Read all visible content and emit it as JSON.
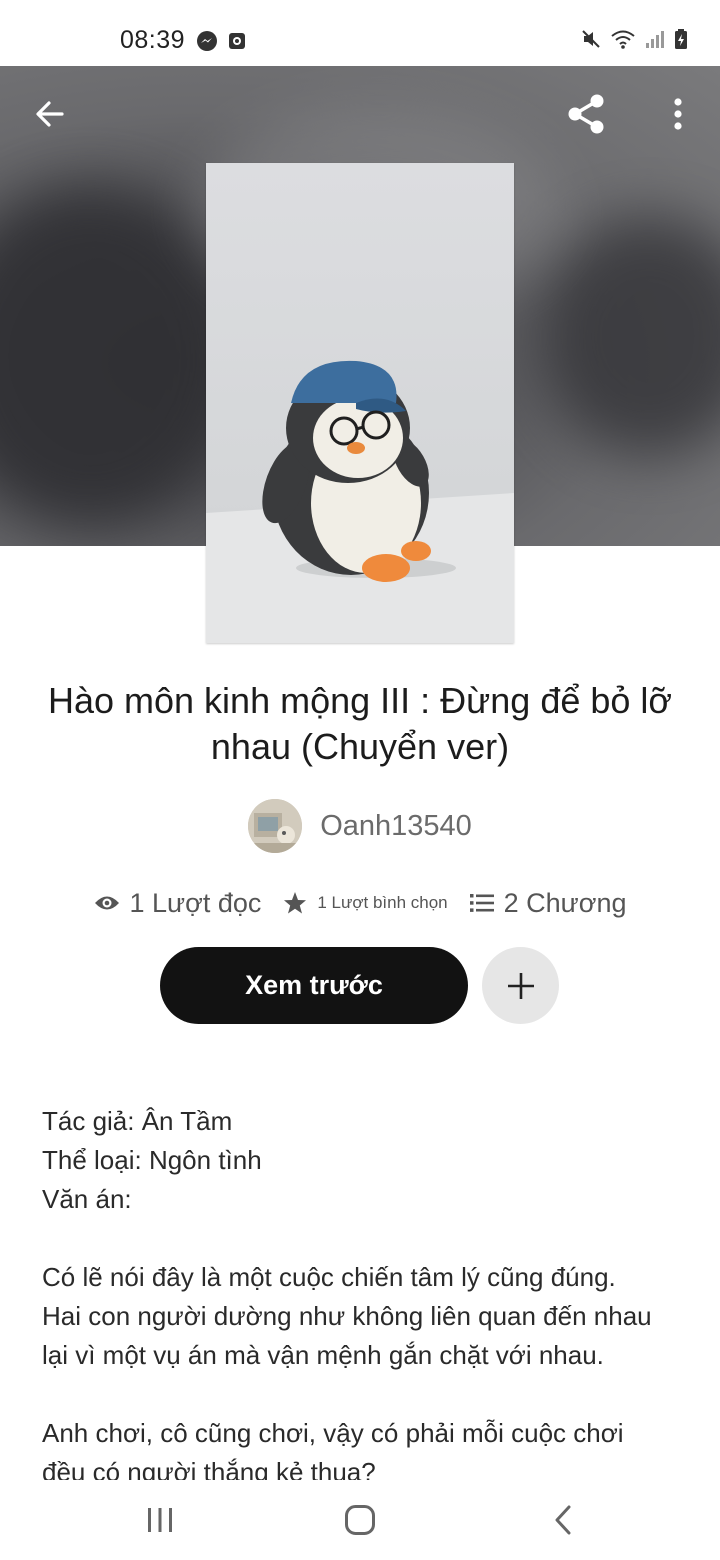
{
  "status_bar": {
    "time": "08:39",
    "left_icons": [
      "messenger-icon",
      "screen-record-icon"
    ],
    "right_icons": [
      "mute-icon",
      "wifi-icon",
      "signal-icon",
      "battery-icon"
    ]
  },
  "header": {
    "back_icon": "arrow-left-icon",
    "share_icon": "share-icon",
    "more_icon": "more-vertical-icon"
  },
  "book": {
    "title": "Hào môn kinh mộng III : Đừng để bỏ lỡ nhau (Chuyển ver)",
    "author": "Oanh13540",
    "stats": {
      "reads": "1 Lượt đọc",
      "votes": "1 Lượt bình chọn",
      "chapters": "2 Chương"
    }
  },
  "actions": {
    "preview_label": "Xem trước",
    "add_icon": "plus-icon"
  },
  "description": {
    "lines": [
      "Tác giả: Ân Tầm",
      "Thể loại: Ngôn tình",
      "Văn án:",
      "",
      "Có lẽ nói đây là một cuộc chiến tâm lý cũng đúng.",
      "Hai con người dường như không liên quan đến nhau",
      "lại vì một vụ án mà vận mệnh gắn chặt với nhau.",
      "",
      "Anh chơi, cô cũng chơi, vậy có phải mỗi cuộc chơi",
      "đều có người thắng kẻ thua?"
    ]
  },
  "colors": {
    "primary_button": "#121212",
    "secondary_button": "#e6e6e6",
    "muted_text": "#6b6b6b"
  },
  "nav_bar": {
    "icons": [
      "recent-apps-icon",
      "home-icon",
      "nav-back-icon"
    ]
  }
}
